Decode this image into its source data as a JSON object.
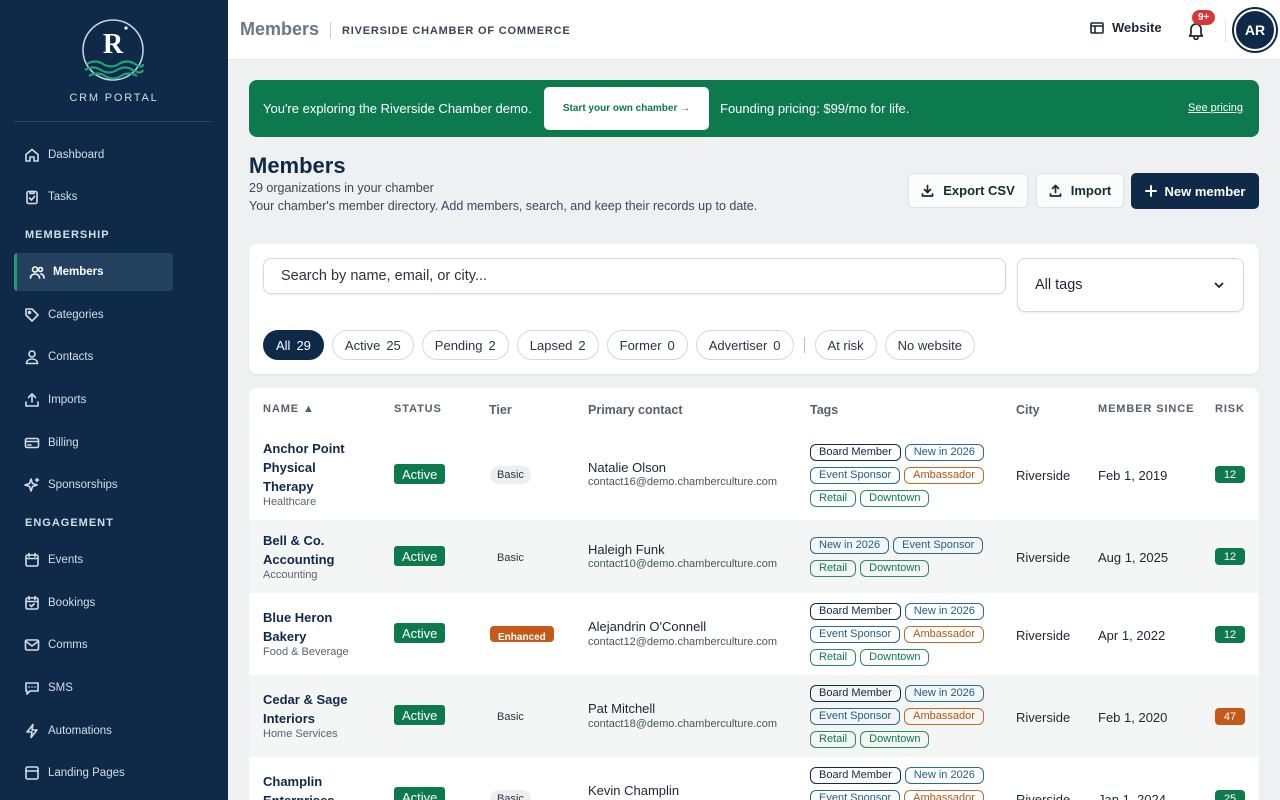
{
  "sidebar": {
    "logo_letter": "R",
    "portal_title": "CRM PORTAL",
    "items": [
      {
        "label": "Dashboard",
        "icon": "home-icon"
      },
      {
        "label": "Tasks",
        "icon": "clipboard-icon"
      },
      {
        "label": "Members",
        "icon": "users-icon",
        "active": true
      },
      {
        "label": "Categories",
        "icon": "tag-icon"
      },
      {
        "label": "Contacts",
        "icon": "user-icon"
      },
      {
        "label": "Imports",
        "icon": "upload-icon"
      },
      {
        "label": "Billing",
        "icon": "billing-icon"
      },
      {
        "label": "Sponsorships",
        "icon": "sparkle-icon"
      },
      {
        "label": "Events",
        "icon": "calendar-icon"
      },
      {
        "label": "Bookings",
        "icon": "calendar-check-icon"
      },
      {
        "label": "Comms",
        "icon": "mail-icon"
      },
      {
        "label": "SMS",
        "icon": "message-icon"
      },
      {
        "label": "Automations",
        "icon": "bolt-icon"
      },
      {
        "label": "Landing Pages",
        "icon": "layout-icon"
      }
    ],
    "sections": {
      "membership": "MEMBERSHIP",
      "engagement": "ENGAGEMENT"
    }
  },
  "topbar": {
    "title": "Members",
    "subtitle": "RIVERSIDE CHAMBER OF COMMERCE",
    "website_label": "Website",
    "notif_badge": "9+",
    "avatar_initials": "AR"
  },
  "banner": {
    "text": "You're exploring the Riverside Chamber demo.",
    "cta": "Start your own chamber →",
    "pricing": "Founding pricing: $99/mo for life.",
    "see_pricing": "See pricing"
  },
  "page": {
    "title": "Members",
    "count": "29 organizations in your chamber",
    "description": "Your chamber's member directory. Add members, search, and keep their records up to date.",
    "export_label": "Export CSV",
    "import_label": "Import",
    "new_member_label": "New member"
  },
  "filters": {
    "search_placeholder": "Search by name, email, or city...",
    "tag_select": "All tags",
    "chips": [
      {
        "label": "All",
        "count": "29",
        "active": true
      },
      {
        "label": "Active",
        "count": "25"
      },
      {
        "label": "Pending",
        "count": "2"
      },
      {
        "label": "Lapsed",
        "count": "2"
      },
      {
        "label": "Former",
        "count": "0"
      },
      {
        "label": "Advertiser",
        "count": "0"
      },
      {
        "label": "At risk",
        "count": ""
      },
      {
        "label": "No website",
        "count": ""
      }
    ]
  },
  "table": {
    "headers": {
      "name": "NAME ▲",
      "status": "STATUS",
      "tier": "Tier",
      "contact": "Primary contact",
      "tags": "Tags",
      "city": "City",
      "since": "MEMBER SINCE",
      "risk": "RISK"
    },
    "rows": [
      {
        "name": "Anchor Point Physical Therapy",
        "category": "Healthcare",
        "status": "Active",
        "tier": "Basic",
        "contact_name": "Natalie Olson",
        "contact_email": "contact16@demo.chamberculture.com",
        "tags": [
          [
            "Board Member",
            "navy"
          ],
          [
            "New in 2026",
            "blue"
          ],
          [
            "Event Sponsor",
            "blue"
          ],
          [
            "Ambassador",
            "orange"
          ],
          [
            "Retail",
            "green"
          ],
          [
            "Downtown",
            "green"
          ]
        ],
        "city": "Riverside",
        "since": "Feb 1, 2019",
        "risk": "12",
        "risk_color": "#0d7a4e"
      },
      {
        "name": "Bell & Co. Accounting",
        "category": "Accounting",
        "status": "Active",
        "tier": "Basic",
        "contact_name": "Haleigh Funk",
        "contact_email": "contact10@demo.chamberculture.com",
        "tags": [
          [
            "New in 2026",
            "blue"
          ],
          [
            "Event Sponsor",
            "blue"
          ],
          [
            "Retail",
            "green"
          ],
          [
            "Downtown",
            "green"
          ]
        ],
        "city": "Riverside",
        "since": "Aug 1, 2025",
        "risk": "12",
        "risk_color": "#0d7a4e"
      },
      {
        "name": "Blue Heron Bakery",
        "category": "Food & Beverage",
        "status": "Active",
        "tier": "Enhanced",
        "contact_name": "Alejandrin O'Connell",
        "contact_email": "contact12@demo.chamberculture.com",
        "tags": [
          [
            "Board Member",
            "navy"
          ],
          [
            "New in 2026",
            "blue"
          ],
          [
            "Event Sponsor",
            "blue"
          ],
          [
            "Ambassador",
            "orange"
          ],
          [
            "Retail",
            "green"
          ],
          [
            "Downtown",
            "green"
          ]
        ],
        "city": "Riverside",
        "since": "Apr 1, 2022",
        "risk": "12",
        "risk_color": "#0d7a4e"
      },
      {
        "name": "Cedar & Sage Interiors",
        "category": "Home Services",
        "status": "Active",
        "tier": "Basic",
        "contact_name": "Pat Mitchell",
        "contact_email": "contact18@demo.chamberculture.com",
        "tags": [
          [
            "Board Member",
            "navy"
          ],
          [
            "New in 2026",
            "blue"
          ],
          [
            "Event Sponsor",
            "blue"
          ],
          [
            "Ambassador",
            "orange"
          ],
          [
            "Retail",
            "green"
          ],
          [
            "Downtown",
            "green"
          ]
        ],
        "city": "Riverside",
        "since": "Feb 1, 2020",
        "risk": "47",
        "risk_color": "#c4591a"
      },
      {
        "name": "Champlin Enterprises",
        "category": "",
        "status": "Active",
        "tier": "Basic",
        "contact_name": "Kevin Champlin",
        "contact_email": "",
        "tags": [
          [
            "Board Member",
            "navy"
          ],
          [
            "New in 2026",
            "blue"
          ],
          [
            "Event Sponsor",
            "blue"
          ],
          [
            "Ambassador",
            "orange"
          ]
        ],
        "city": "Riverside",
        "since": "Jan 1, 2024",
        "risk": "25",
        "risk_color": "#0d7a4e"
      }
    ]
  },
  "colors": {
    "navy": "#0f2a48",
    "green": "#0d7a4e",
    "orange": "#c4591a",
    "alert": "#d93636"
  }
}
